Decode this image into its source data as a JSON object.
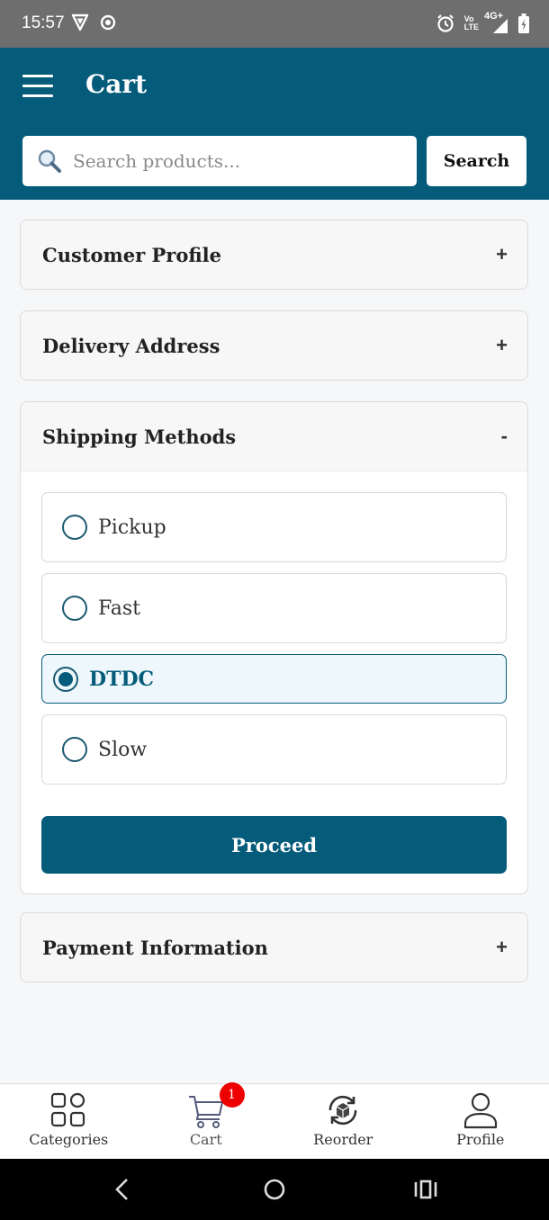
{
  "status_bar": {
    "time": "15:57",
    "left_icons": [
      "vpn-icon",
      "eye-icon"
    ],
    "right_icons": [
      "alarm-icon",
      "volte-icon",
      "signal-icon",
      "battery-icon"
    ],
    "volte_top": "Vo",
    "volte_bottom": "LTE",
    "network": "4G+"
  },
  "header": {
    "title": "Cart",
    "search_placeholder": "Search products...",
    "search_value": "",
    "search_button": "Search",
    "background": "#055b7a"
  },
  "panels": {
    "customer_profile": {
      "title": "Customer Profile",
      "toggle": "+"
    },
    "delivery_address": {
      "title": "Delivery Address",
      "toggle": "+"
    },
    "shipping_methods": {
      "title": "Shipping Methods",
      "toggle": "-",
      "options": [
        {
          "label": "Pickup",
          "selected": false
        },
        {
          "label": "Fast",
          "selected": false
        },
        {
          "label": "DTDC",
          "selected": true
        },
        {
          "label": "Slow",
          "selected": false
        }
      ],
      "proceed_label": "Proceed"
    },
    "payment_information": {
      "title": "Payment Information",
      "toggle": "+"
    }
  },
  "bottom_nav": {
    "items": [
      {
        "label": "Categories",
        "icon": "grid-icon"
      },
      {
        "label": "Cart",
        "icon": "cart-icon",
        "badge": "1",
        "active": true
      },
      {
        "label": "Reorder",
        "icon": "reorder-icon"
      },
      {
        "label": "Profile",
        "icon": "person-icon"
      }
    ]
  },
  "system_nav": {
    "icons": [
      "back-icon",
      "home-icon",
      "recents-icon"
    ]
  },
  "colors": {
    "primary": "#055b7a",
    "badge": "#ee0000",
    "selected_bg": "#eef8fc"
  }
}
